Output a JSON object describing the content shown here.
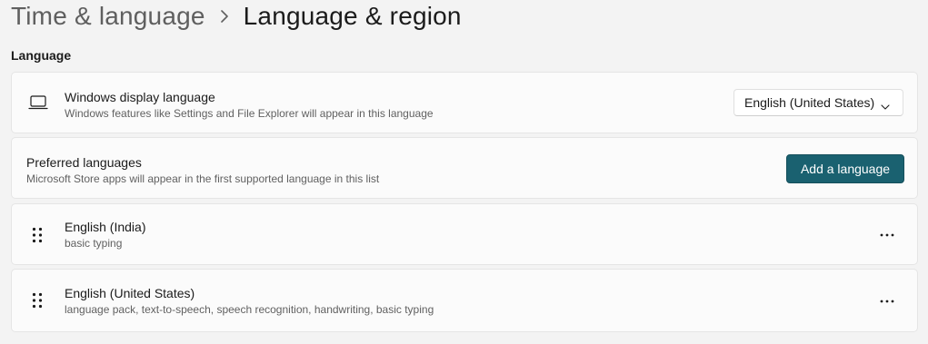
{
  "breadcrumb": {
    "parent": "Time & language",
    "separator_icon": "chevron-right-icon",
    "current": "Language & region"
  },
  "language_section": {
    "title": "Language"
  },
  "display_language": {
    "icon": "laptop-icon",
    "title": "Windows display language",
    "description": "Windows features like Settings and File Explorer will appear in this language",
    "selected": "English (United States)"
  },
  "preferred_languages": {
    "title": "Preferred languages",
    "description": "Microsoft Store apps will appear in the first supported language in this list",
    "add_button_label": "Add a language"
  },
  "languages": [
    {
      "name": "English (India)",
      "features": "basic typing"
    },
    {
      "name": "English (United States)",
      "features": "language pack, text-to-speech, speech recognition, handwriting, basic typing"
    }
  ],
  "colors": {
    "accent": "#1a6170",
    "background": "#f3f3f3",
    "card": "#fbfbfb"
  }
}
